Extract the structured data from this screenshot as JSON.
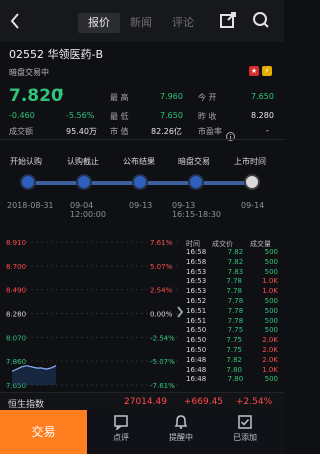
{
  "topbar": {
    "tabs": [
      {
        "label": "报价",
        "active": true
      },
      {
        "label": "新闻",
        "active": false
      },
      {
        "label": "评论",
        "active": false
      }
    ],
    "icons": {
      "back": "chevron-left-icon",
      "share": "share-icon",
      "search": "search-icon"
    }
  },
  "stock": {
    "code_name": "02552 华领医药-B",
    "status": "暗盘交易中",
    "price": "7.820",
    "change": "-0.460",
    "change_pct": "-5.56%",
    "turnover_label": "成交额",
    "turnover": "95.40万",
    "high_label": "最 高",
    "high": "7.960",
    "low_label": "最 低",
    "low": "7.650",
    "market_cap_label": "市 值",
    "market_cap": "82.26亿",
    "open_label": "今 开",
    "open": "7.650",
    "prev_close_label": "昨 收",
    "prev_close": "8.280",
    "pe_label": "市盈率",
    "pe_icon": "info-icon",
    "pe_value": "-",
    "colors": {
      "up": "#ff4b4b",
      "down": "#33c37b",
      "accent": "#ff7f20"
    }
  },
  "ipo_progress": {
    "steps": [
      {
        "label": "开始认购",
        "date": "2018-08-31"
      },
      {
        "label": "认购截止",
        "date": "09-04\n12:00:00"
      },
      {
        "label": "公布结果",
        "date": "09-13"
      },
      {
        "label": "暗盘交易",
        "date": "09-13\n16:15-18:30"
      },
      {
        "label": "上市时间",
        "date": "09-14"
      }
    ]
  },
  "chart_data": {
    "type": "line",
    "title": "",
    "xlabel": "",
    "ylabel": "",
    "y_ticks": [
      "8.910",
      "8.700",
      "8.490",
      "8.280",
      "8.070",
      "7.860",
      "7.650"
    ],
    "pct_ticks": [
      "7.61%",
      "5.07%",
      "2.54%",
      "0.00%",
      "-2.54%",
      "-5.07%",
      "-7.61%"
    ],
    "series": [
      {
        "values": [
          7.77,
          7.79,
          7.81,
          7.82,
          7.81,
          7.8,
          7.8,
          7.79,
          7.8,
          7.82
        ]
      }
    ],
    "ylim": [
      7.65,
      8.91
    ]
  },
  "trades": {
    "headers": [
      "时间",
      "成交价",
      "成交量"
    ],
    "rows": [
      [
        "16:58",
        "7.82",
        "500"
      ],
      [
        "16:58",
        "7.82",
        "500"
      ],
      [
        "16:53",
        "7.83",
        "500"
      ],
      [
        "16:53",
        "7.78",
        "1.0K"
      ],
      [
        "16:53",
        "7.78",
        "1.0K"
      ],
      [
        "16:52",
        "7.78",
        "500"
      ],
      [
        "16:51",
        "7.78",
        "500"
      ],
      [
        "16:51",
        "7.78",
        "500"
      ],
      [
        "16:50",
        "7.75",
        "500"
      ],
      [
        "16:50",
        "7.75",
        "2.0K"
      ],
      [
        "16:50",
        "7.75",
        "2.0K"
      ],
      [
        "16:48",
        "7.82",
        "2.0K"
      ],
      [
        "16:48",
        "7.80",
        "1.0K"
      ],
      [
        "16:48",
        "7.80",
        "500"
      ]
    ]
  },
  "index_bar": {
    "label": "恒生指数",
    "value": "27014.49",
    "change": "+669.45",
    "change_pct": "+2.54%"
  },
  "bottom_nav": {
    "buy": "交易",
    "items": [
      {
        "label": "点评",
        "icon": "comment-icon"
      },
      {
        "label": "提醒中",
        "icon": "bell-icon"
      },
      {
        "label": "已添加",
        "icon": "check-box-icon"
      }
    ]
  }
}
